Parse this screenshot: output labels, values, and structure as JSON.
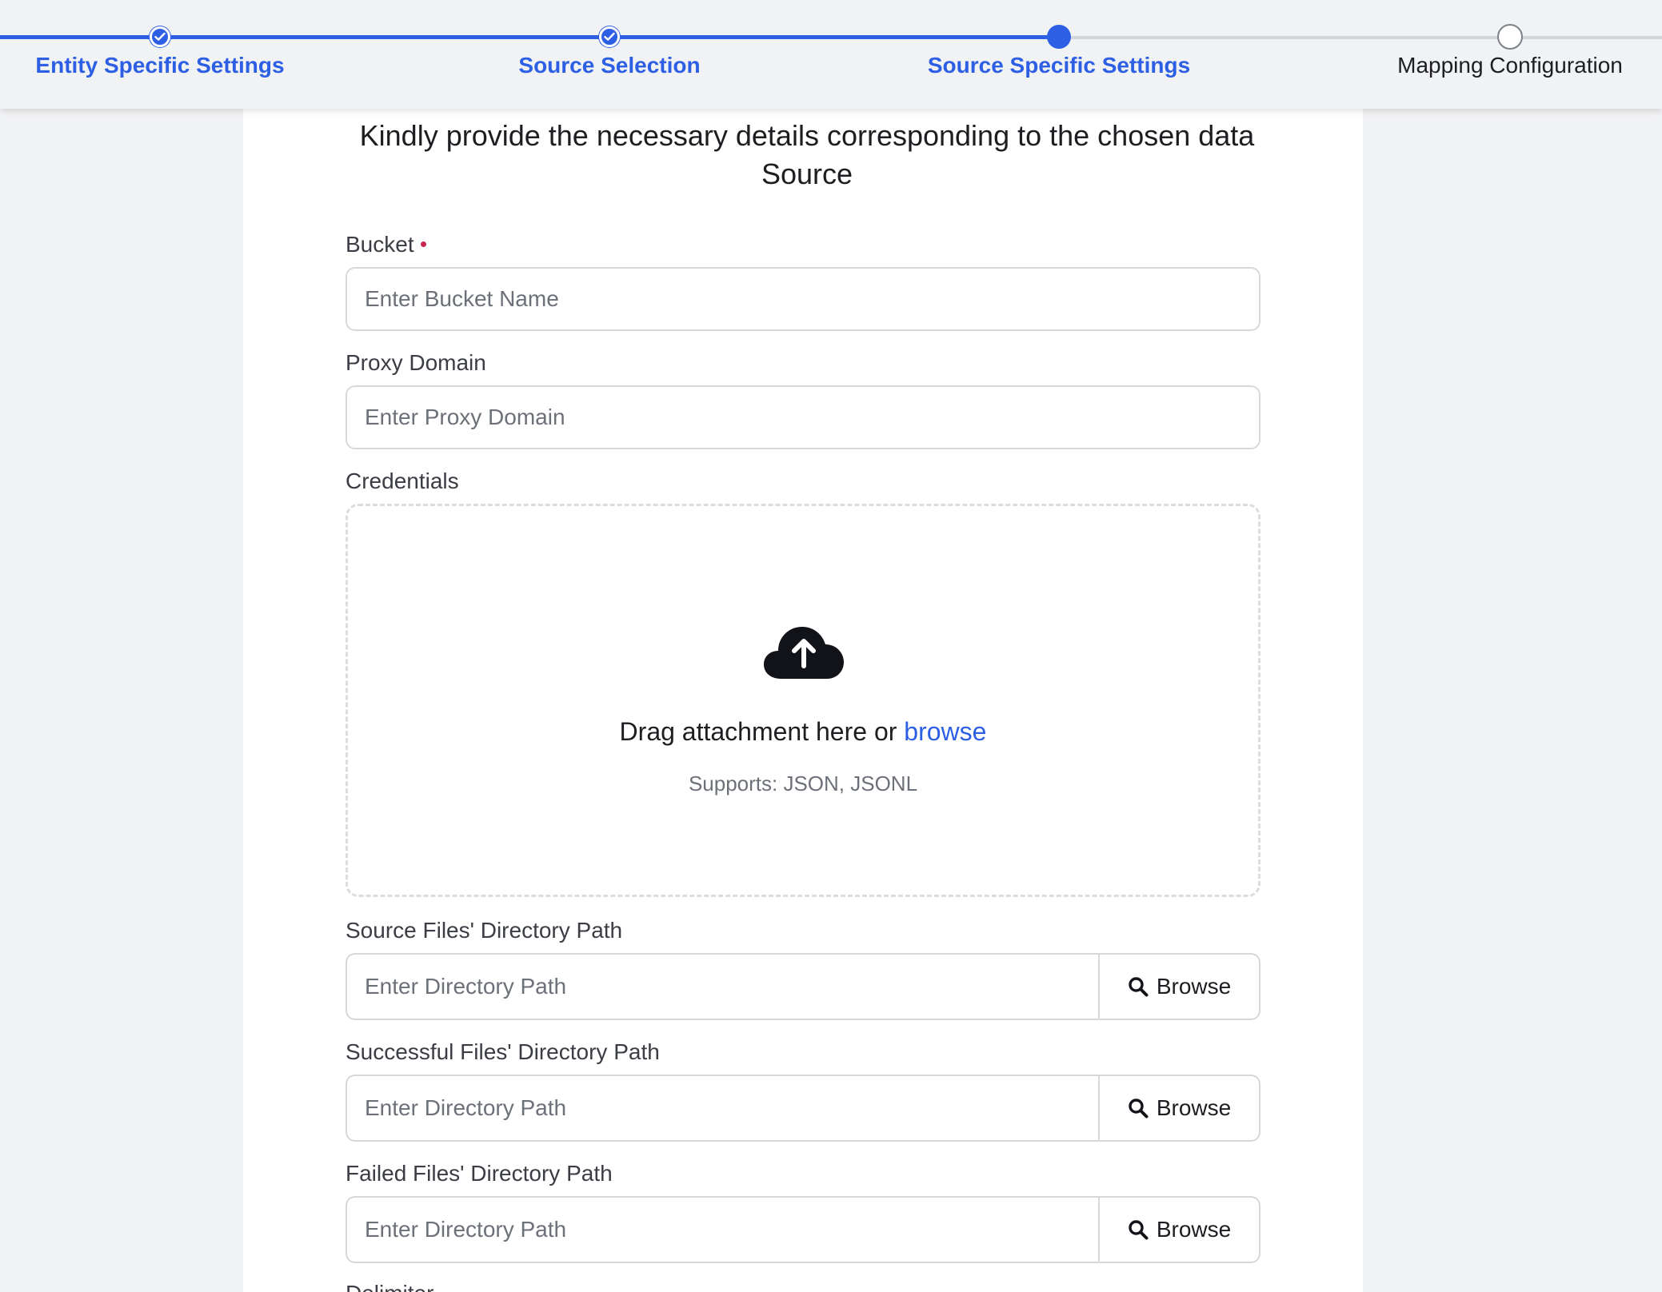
{
  "stepper": {
    "steps": [
      {
        "label": "Entity Specific Settings",
        "state": "done"
      },
      {
        "label": "Source Selection",
        "state": "done"
      },
      {
        "label": "Source Specific Settings",
        "state": "current"
      },
      {
        "label": "Mapping Configuration",
        "state": "todo"
      }
    ]
  },
  "form": {
    "heading": "Kindly provide the necessary details corresponding to the chosen data Source",
    "bucket": {
      "label": "Bucket",
      "required": true,
      "placeholder": "Enter Bucket Name",
      "value": ""
    },
    "proxy_domain": {
      "label": "Proxy Domain",
      "placeholder": "Enter Proxy Domain",
      "value": ""
    },
    "credentials": {
      "label": "Credentials",
      "drop_text": "Drag attachment here or",
      "browse_link": "browse",
      "supports": "Supports: JSON, JSONL",
      "icon": "cloud-upload-icon"
    },
    "source_dir": {
      "label": "Source Files' Directory Path",
      "placeholder": "Enter Directory Path",
      "button": "Browse"
    },
    "success_dir": {
      "label": "Successful Files' Directory Path",
      "placeholder": "Enter Directory Path",
      "button": "Browse"
    },
    "failed_dir": {
      "label": "Failed Files' Directory Path",
      "placeholder": "Enter Directory Path",
      "button": "Browse"
    },
    "next_field_label": "Delimiter"
  },
  "colors": {
    "accent": "#2d5fe4",
    "required": "#c8254d",
    "background": "#f1f2f4"
  }
}
